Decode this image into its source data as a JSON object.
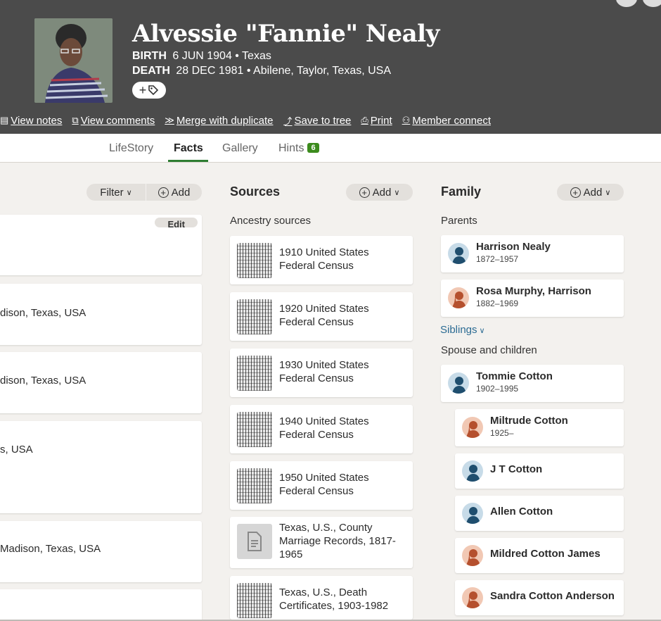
{
  "person": {
    "name": "Alvessie \"Fannie\" Nealy",
    "birth_label": "BIRTH",
    "birth_value": "6 JUN 1904 • Texas",
    "death_label": "DEATH",
    "death_value": "28 DEC 1981 • Abilene, Taylor, Texas, USA"
  },
  "actions": [
    {
      "label": "View notes",
      "icon": "notes-icon"
    },
    {
      "label": "View comments",
      "icon": "comments-icon"
    },
    {
      "label": "Merge with duplicate",
      "icon": "merge-icon"
    },
    {
      "label": "Save to tree",
      "icon": "save-icon"
    },
    {
      "label": "Print",
      "icon": "print-icon"
    },
    {
      "label": "Member connect",
      "icon": "members-icon"
    }
  ],
  "tabs": [
    {
      "label": "LifeStory"
    },
    {
      "label": "Facts"
    },
    {
      "label": "Gallery"
    },
    {
      "label": "Hints",
      "badge": "6"
    }
  ],
  "facts": {
    "filter_label": "Filter",
    "add_label": "Add",
    "edit_label": "Edit",
    "rows": [
      {
        "text": "dison, Texas, USA"
      },
      {
        "text": "dison, Texas, USA"
      },
      {
        "text": "s, USA"
      },
      {
        "text": "Madison, Texas, USA"
      }
    ]
  },
  "sources": {
    "title": "Sources",
    "add_label": "Add",
    "subtitle": "Ancestry sources",
    "items": [
      {
        "title": "1910 United States Federal Census"
      },
      {
        "title": "1920 United States Federal Census"
      },
      {
        "title": "1930 United States Federal Census"
      },
      {
        "title": "1940 United States Federal Census"
      },
      {
        "title": "1950 United States Federal Census"
      },
      {
        "title": "Texas, U.S., County Marriage Records, 1817-1965"
      },
      {
        "title": "Texas, U.S., Death Certificates, 1903-1982"
      }
    ]
  },
  "family": {
    "title": "Family",
    "add_label": "Add",
    "parents_label": "Parents",
    "siblings_label": "Siblings",
    "spouse_label": "Spouse and children",
    "parents": [
      {
        "name": "Harrison Nealy",
        "years": "1872–1957",
        "gender": "male"
      },
      {
        "name": "Rosa Murphy, Harrison",
        "years": "1882–1969",
        "gender": "female"
      }
    ],
    "spouse": {
      "name": "Tommie Cotton",
      "years": "1902–1995",
      "gender": "male"
    },
    "children": [
      {
        "name": "Miltrude Cotton",
        "years": "1925–",
        "gender": "female"
      },
      {
        "name": "J T Cotton",
        "years": "",
        "gender": "male"
      },
      {
        "name": "Allen Cotton",
        "years": "",
        "gender": "male"
      },
      {
        "name": "Mildred Cotton James",
        "years": "",
        "gender": "female"
      },
      {
        "name": "Sandra Cotton Anderson",
        "years": "",
        "gender": "female"
      }
    ]
  },
  "colors": {
    "header_bg": "#4b4b4b",
    "active_tab": "#2e7d32",
    "hint_badge": "#3c8b1d",
    "link": "#2b6b93"
  }
}
